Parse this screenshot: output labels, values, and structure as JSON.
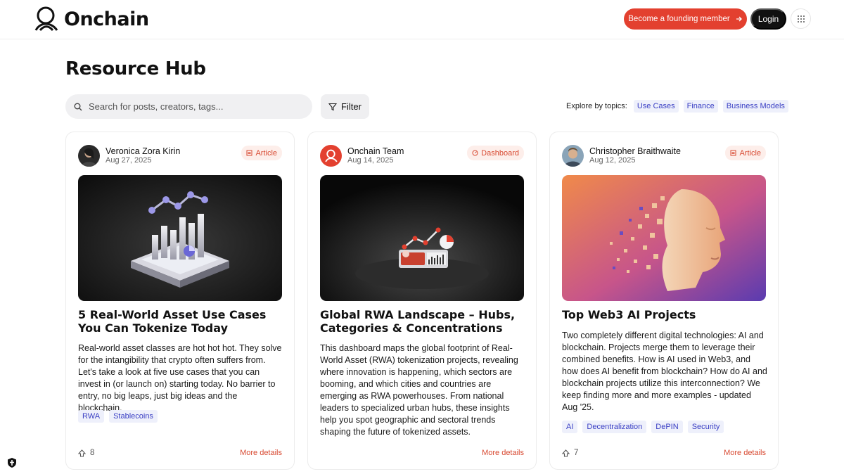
{
  "header": {
    "logo_text": "Onchain",
    "founding_button": "Become a founding member",
    "login_button": "Login"
  },
  "page": {
    "title": "Resource Hub"
  },
  "search": {
    "placeholder": "Search for posts, creators, tags..."
  },
  "filter": {
    "label": "Filter"
  },
  "topics": {
    "label": "Explore by topics:",
    "items": [
      "Use Cases",
      "Finance",
      "Business Models"
    ]
  },
  "colors": {
    "accent": "#e3402f",
    "tag_text": "#3a3fc4",
    "tag_bg": "#eef0fb"
  },
  "cards": [
    {
      "author": "Veronica Zora Kirin",
      "date": "Aug 27, 2025",
      "type": "Article",
      "title": "5 Real-World Asset Use Cases You Can Tokenize Today",
      "description": "Real-world asset classes are hot hot hot. They solve for the intangibility that crypto often suffers from. Let's take a look at five use cases that you can invest in (or launch on) starting today. No barrier to entry, no big leaps, just big ideas and the blockchain.",
      "tags": [
        "RWA",
        "Stablecoins"
      ],
      "likes": "8",
      "more": "More details"
    },
    {
      "author": "Onchain Team",
      "date": "Aug 14, 2025",
      "type": "Dashboard",
      "title": "Global RWA Landscape – Hubs, Categories & Concentrations",
      "description": "This dashboard maps the global footprint of Real-World Asset (RWA) tokenization projects, revealing where innovation is happening, which sectors are booming, and which cities and countries are emerging as RWA powerhouses. From national leaders to specialized urban hubs, these insights help you spot geographic and sectoral trends shaping the future of tokenized assets.",
      "tags": [],
      "likes": "",
      "more": "More details"
    },
    {
      "author": "Christopher Braithwaite",
      "date": "Aug 12, 2025",
      "type": "Article",
      "title": "Top Web3 AI Projects",
      "description": "Two completely different digital technologies: AI and blockchain. Projects merge them to leverage their combined benefits. How is AI used in Web3, and how does AI benefit from blockchain? How do AI and blockchain projects utilize this interconnection? We keep finding more and more examples - updated Aug '25.",
      "tags": [
        "AI",
        "Decentralization",
        "DePIN",
        "Security"
      ],
      "likes": "7",
      "more": "More details"
    }
  ]
}
